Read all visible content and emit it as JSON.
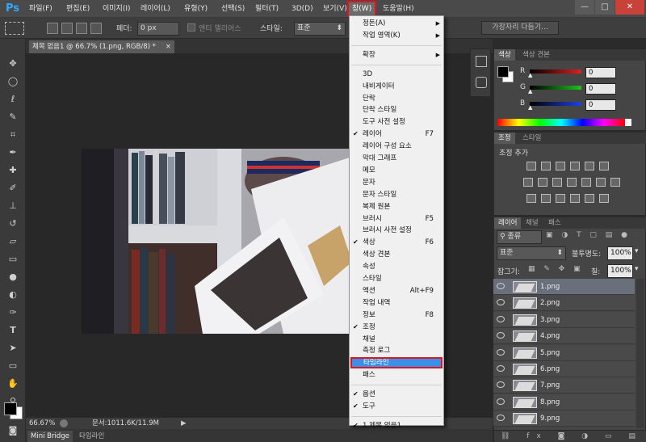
{
  "app": {
    "logo": "Ps"
  },
  "menubar": {
    "items": [
      "파일(F)",
      "편집(E)",
      "이미지(I)",
      "레이어(L)",
      "유형(Y)",
      "선택(S)",
      "필터(T)",
      "3D(D)",
      "보기(V)",
      "창(W)",
      "도움말(H)"
    ],
    "active_index": 9
  },
  "window_controls": {
    "minimize": "—",
    "maximize": "□",
    "close": "✕"
  },
  "options_bar": {
    "feather_label": "페더:",
    "feather_value": "0 px",
    "antialias_label": "앤티 앨리어스",
    "style_label": "스타일:",
    "style_value": "표준",
    "edge_button": "가장자리 다듬기..."
  },
  "document": {
    "tab_title": "제목 없음1 @ 66.7% (1.png, RGB/8) *",
    "zoom": "66.67%",
    "doc_info": "문서:1011.6K/11.9M"
  },
  "bottom_tabs": [
    "Mini Bridge",
    "타임라인"
  ],
  "window_menu": {
    "items": [
      {
        "label": "정돈(A)",
        "submenu": true
      },
      {
        "label": "작업 영역(K)",
        "submenu": true
      },
      {
        "sep": true
      },
      {
        "label": "확장",
        "submenu": true
      },
      {
        "sep": true
      },
      {
        "label": "3D"
      },
      {
        "label": "내비게이터"
      },
      {
        "label": "단락"
      },
      {
        "label": "단락 스타일"
      },
      {
        "label": "도구 사전 설정"
      },
      {
        "label": "레이어",
        "checked": true,
        "shortcut": "F7"
      },
      {
        "label": "레이어 구성 요소"
      },
      {
        "label": "막대 그래프"
      },
      {
        "label": "메모"
      },
      {
        "label": "문자"
      },
      {
        "label": "문자 스타일"
      },
      {
        "label": "복제 원본"
      },
      {
        "label": "브러시",
        "shortcut": "F5"
      },
      {
        "label": "브러시 사전 설정"
      },
      {
        "label": "색상",
        "checked": true,
        "shortcut": "F6"
      },
      {
        "label": "색상 견본"
      },
      {
        "label": "속성"
      },
      {
        "label": "스타일"
      },
      {
        "label": "액션",
        "shortcut": "Alt+F9"
      },
      {
        "label": "작업 내역"
      },
      {
        "label": "정보",
        "shortcut": "F8"
      },
      {
        "label": "조정",
        "checked": true
      },
      {
        "label": "채널"
      },
      {
        "label": "측정 로그"
      },
      {
        "label": "타임라인",
        "highlighted": true
      },
      {
        "label": "패스"
      },
      {
        "sep": true
      },
      {
        "label": "옵션",
        "checked": true
      },
      {
        "label": "도구",
        "checked": true
      },
      {
        "sep": true
      },
      {
        "label": "1 제목 없음1",
        "checked": true
      }
    ]
  },
  "color_panel": {
    "tabs": [
      "색상",
      "색상 견본"
    ],
    "channels": [
      {
        "name": "R",
        "value": "0",
        "color": "#e02020"
      },
      {
        "name": "G",
        "value": "0",
        "color": "#20c020"
      },
      {
        "name": "B",
        "value": "0",
        "color": "#2040e0"
      }
    ]
  },
  "adjust_panel": {
    "tabs": [
      "조정",
      "스타일"
    ],
    "title": "조정 추가"
  },
  "layers_panel": {
    "tabs": [
      "레이어",
      "채널",
      "패스"
    ],
    "filter": "종류",
    "blend_mode": "표준",
    "opacity_label": "불투명도:",
    "opacity_value": "100%",
    "lock_label": "잠그기:",
    "fill_label": "칠:",
    "fill_value": "100%",
    "layers": [
      "1.png",
      "2.png",
      "3.png",
      "4.png",
      "5.png",
      "6.png",
      "7.png",
      "8.png",
      "9.png"
    ],
    "selected_index": 0
  },
  "colors": {
    "accent": "#3a8fe8",
    "highlight_border": "#e0141e"
  }
}
